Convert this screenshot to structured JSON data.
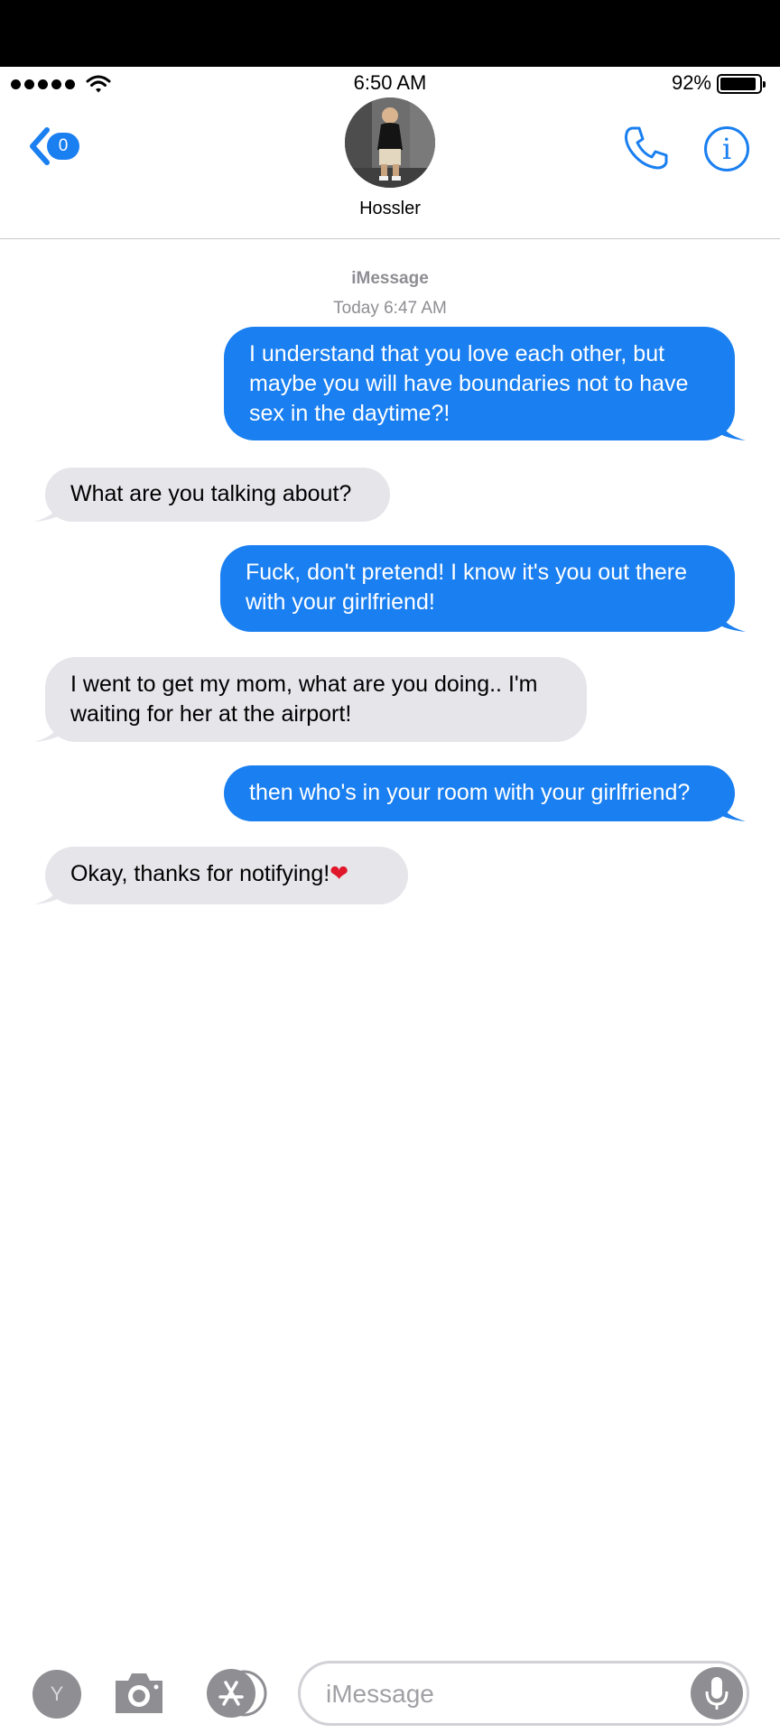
{
  "status_bar": {
    "time": "6:50 AM",
    "battery_percent": "92%",
    "battery_level": 0.92
  },
  "nav": {
    "back_badge": "0",
    "contact_name": "Hossler",
    "icons": [
      "chevron-left-icon",
      "phone-icon",
      "info-icon"
    ]
  },
  "thread": {
    "service": "iMessage",
    "timestamp": "Today 6:47 AM",
    "messages": [
      {
        "direction": "sent",
        "lines": [
          "I understand that you love each other, but",
          "maybe you will have boundaries not to have",
          "sex in the daytime?!"
        ]
      },
      {
        "direction": "received",
        "lines": [
          "What are you talking about?"
        ]
      },
      {
        "direction": "sent",
        "lines": [
          "Fuck, don't pretend! I know it's you out there",
          "with your girlfriend!"
        ]
      },
      {
        "direction": "received",
        "lines": [
          "I went to get my mom, what are you doing.. I'm",
          "waiting for her at the airport!"
        ]
      },
      {
        "direction": "sent",
        "lines": [
          "then who's in your room with your girlfriend?"
        ]
      },
      {
        "direction": "received",
        "text": "Okay, thanks for notifying!",
        "emoji": "❤"
      }
    ]
  },
  "toolbar": {
    "avatar_letter": "Y",
    "input_placeholder": "iMessage",
    "input_value": ""
  },
  "colors": {
    "sent_bubble": "#1a7ff0",
    "received_bubble": "#e6e5ea",
    "accent": "#1a7ff0"
  }
}
